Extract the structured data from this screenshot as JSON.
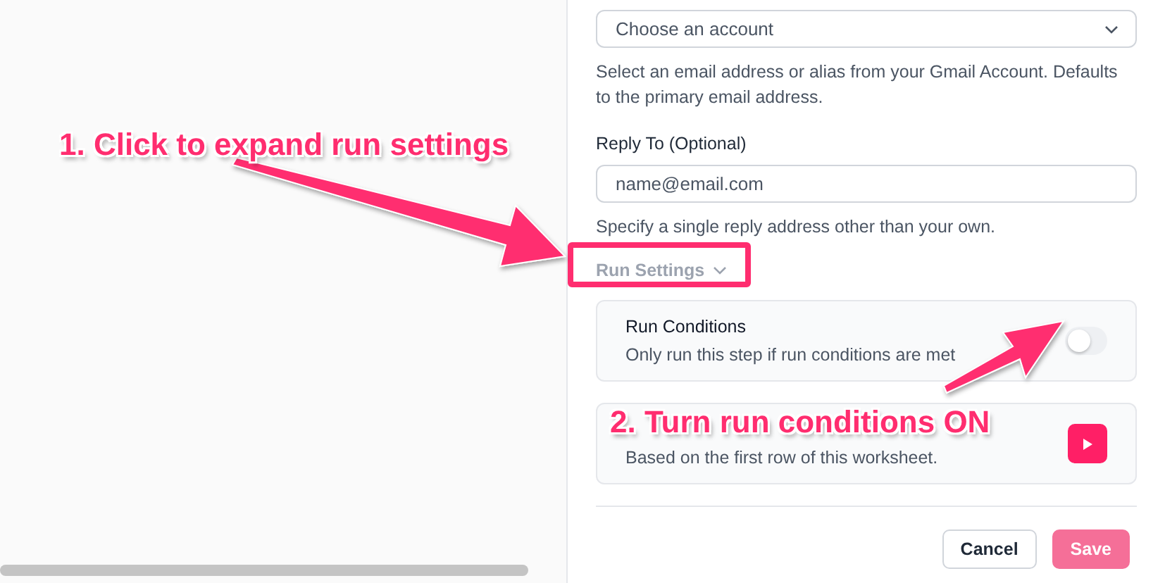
{
  "account_select": {
    "placeholder": "Choose an account",
    "help": "Select an email address or alias from your Gmail Account. Defaults to the primary email address."
  },
  "reply_to": {
    "label": "Reply To (Optional)",
    "placeholder": "name@email.com",
    "help": "Specify a single reply address other than your own."
  },
  "run_settings": {
    "label": "Run Settings",
    "expanded": true
  },
  "run_conditions": {
    "title": "Run Conditions",
    "description": "Only run this step if run conditions are met",
    "on": false
  },
  "preview": {
    "description": "Based on the first row of this worksheet."
  },
  "footer": {
    "buttons": [
      {
        "label": "Cancel",
        "kind": "secondary",
        "disabled": false
      },
      {
        "label": "Save",
        "kind": "primary",
        "disabled": true
      }
    ]
  },
  "annotations": [
    {
      "text": "1. Click to expand run settings"
    },
    {
      "text": "2. Turn run conditions ON"
    }
  ]
}
